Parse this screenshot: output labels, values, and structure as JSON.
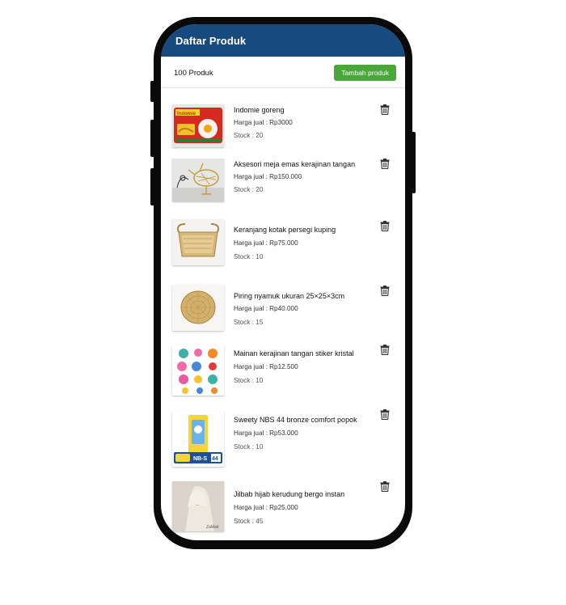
{
  "header": {
    "title": "Daftar Produk"
  },
  "toolbar": {
    "count": "100 Produk",
    "add_label": "Tambah produk"
  },
  "products": [
    {
      "name": "Indomie goreng",
      "price": "Harga jual : Rp3000",
      "stock": "Stock : 20",
      "image": "indomie-image"
    },
    {
      "name": "Aksesori meja emas kerajinan tangan",
      "price": "Harga jual : Rp150.000",
      "stock": "Stock : 20",
      "image": "gold-bird-image"
    },
    {
      "name": "Keranjang kotak persegi kuping",
      "price": "Harga jual : Rp75.000",
      "stock": "Stock : 10",
      "image": "basket-image"
    },
    {
      "name": "Piring nyamuk ukuran 25×25×3cm",
      "price": "Harga jual : Rp40.000",
      "stock": "Stock : 15",
      "image": "woven-plate-image"
    },
    {
      "name": "Mainan kerajinan tangan stiker kristal",
      "price": "Harga jual : Rp12.500",
      "stock": "Stock : 10",
      "image": "sticker-image"
    },
    {
      "name": "Sweety NBS 44 bronze comfort popok",
      "price": "Harga jual : Rp53.000",
      "stock": "Stock : 10",
      "image": "diaper-image"
    },
    {
      "name": "Jilbab hijab kerudung bergo instan",
      "price": "Harga jual : Rp25.000",
      "stock": "Stock : 45",
      "image": "hijab-image"
    }
  ],
  "icons": {
    "delete": "trash-icon"
  },
  "colors": {
    "header": "#174a7e",
    "add_button": "#4aa83a"
  }
}
